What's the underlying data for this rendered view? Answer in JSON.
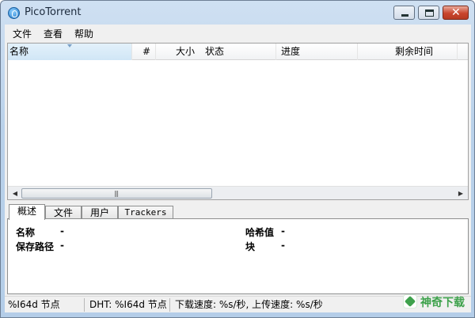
{
  "window": {
    "title": "PicoTorrent"
  },
  "menubar": {
    "items": [
      "文件",
      "查看",
      "帮助"
    ]
  },
  "list": {
    "columns": {
      "name": "名称",
      "num": "#",
      "size": "大小",
      "status": "状态",
      "progress": "进度",
      "remaining": "剩余时间"
    },
    "rows": []
  },
  "tabs": [
    "概述",
    "文件",
    "用户",
    "Trackers"
  ],
  "overview": {
    "name_label": "名称",
    "name_value": "-",
    "path_label": "保存路径",
    "path_value": "-",
    "hash_label": "哈希值",
    "hash_value": "-",
    "block_label": "块",
    "block_value": "-"
  },
  "status": {
    "nodes": "%I64d 节点",
    "dht": "DHT: %I64d 节点",
    "speed": "下载速度: %s/秒, 上传速度: %s/秒"
  },
  "watermark": {
    "text": "神奇下载"
  }
}
